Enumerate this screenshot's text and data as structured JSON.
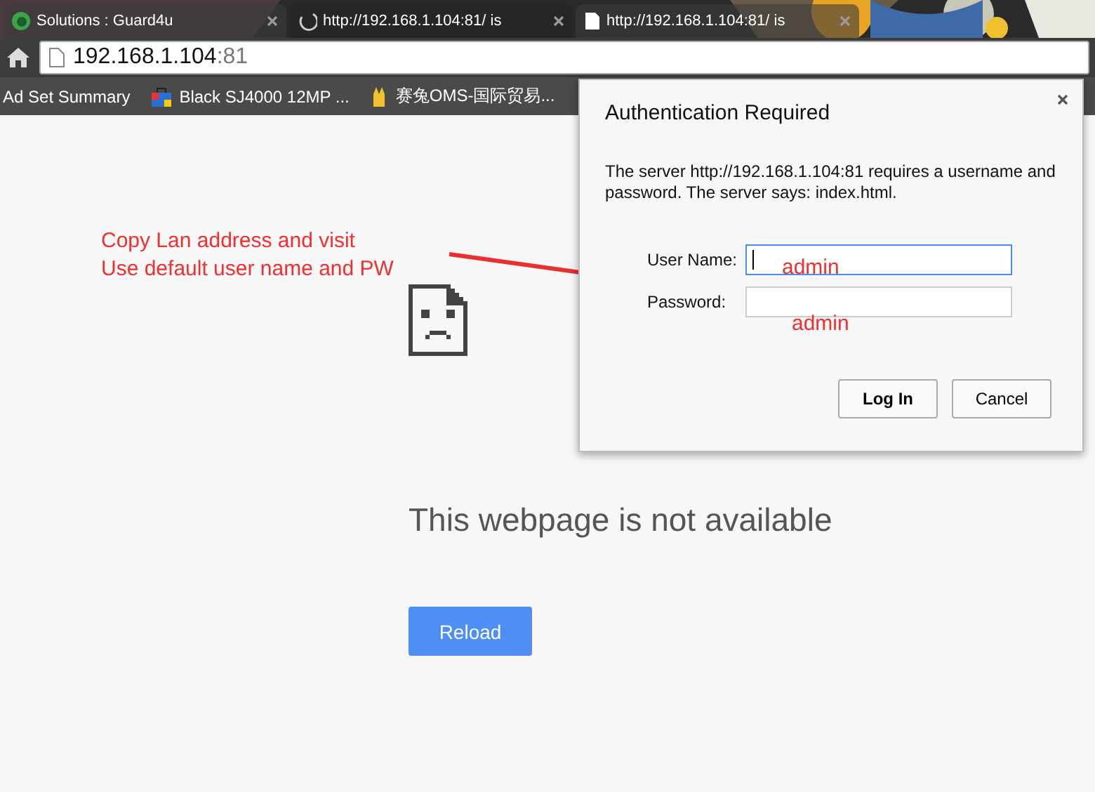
{
  "tabs": [
    {
      "title": "Solutions : Guard4u",
      "selected": false
    },
    {
      "title": "http://192.168.1.104:81/ is",
      "selected": true
    },
    {
      "title": "http://192.168.1.104:81/ is",
      "selected": false
    }
  ],
  "address_bar": {
    "host": "192.168.1.104",
    "port": ":81"
  },
  "bookmarks": [
    {
      "title": "Ad Set Summary"
    },
    {
      "title": "Black SJ4000 12MP ..."
    },
    {
      "title": "赛兔OMS-国际贸易..."
    }
  ],
  "error_page": {
    "heading": "This webpage is not available",
    "button": "Reload"
  },
  "dialog": {
    "title": "Authentication Required",
    "message": "The server http://192.168.1.104:81 requires a username and password. The server says: index.html.",
    "fields": [
      {
        "label": "User Name:",
        "focused": true,
        "hint": "admin"
      },
      {
        "label": "Password:",
        "focused": false,
        "hint": "admin"
      }
    ],
    "buttons": [
      {
        "label": "Log In",
        "default": true
      },
      {
        "label": "Cancel",
        "default": false
      }
    ]
  },
  "annotation": {
    "lines": [
      "Copy Lan address and visit",
      "Use default user name and PW"
    ]
  }
}
